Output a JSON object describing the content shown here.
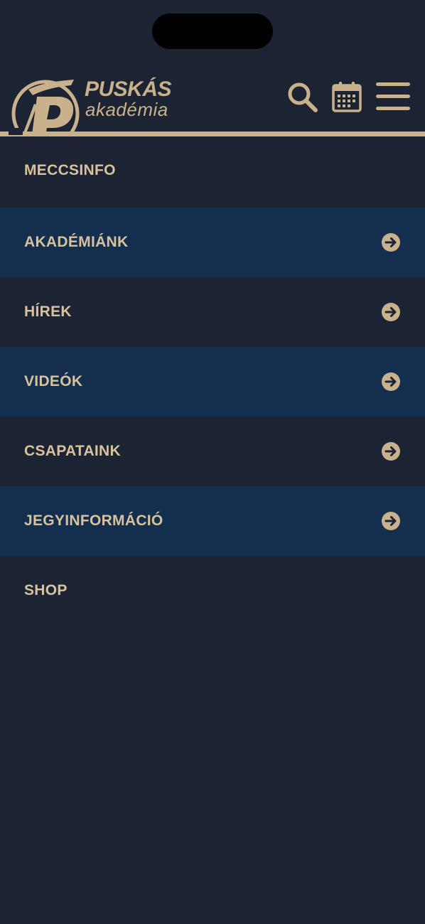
{
  "header": {
    "brand_name": "PUSKÁS",
    "brand_sub": "akadémia",
    "icons": {
      "search": "search-icon",
      "calendar": "calendar-icon",
      "menu": "hamburger-menu-icon"
    }
  },
  "nav": {
    "items": [
      {
        "label": "MECCSINFO",
        "has_arrow": false
      },
      {
        "label": "AKADÉMIÁNK",
        "has_arrow": true
      },
      {
        "label": "HÍREK",
        "has_arrow": true
      },
      {
        "label": "VIDEÓK",
        "has_arrow": true
      },
      {
        "label": "CSAPATAINK",
        "has_arrow": true
      },
      {
        "label": "JEGYINFORMÁCIÓ",
        "has_arrow": true
      },
      {
        "label": "SHOP",
        "has_arrow": false
      }
    ]
  },
  "colors": {
    "background": "#1c2434",
    "row_alt": "#142e4d",
    "gold": "#c9b28b",
    "label": "#d7c29d"
  }
}
